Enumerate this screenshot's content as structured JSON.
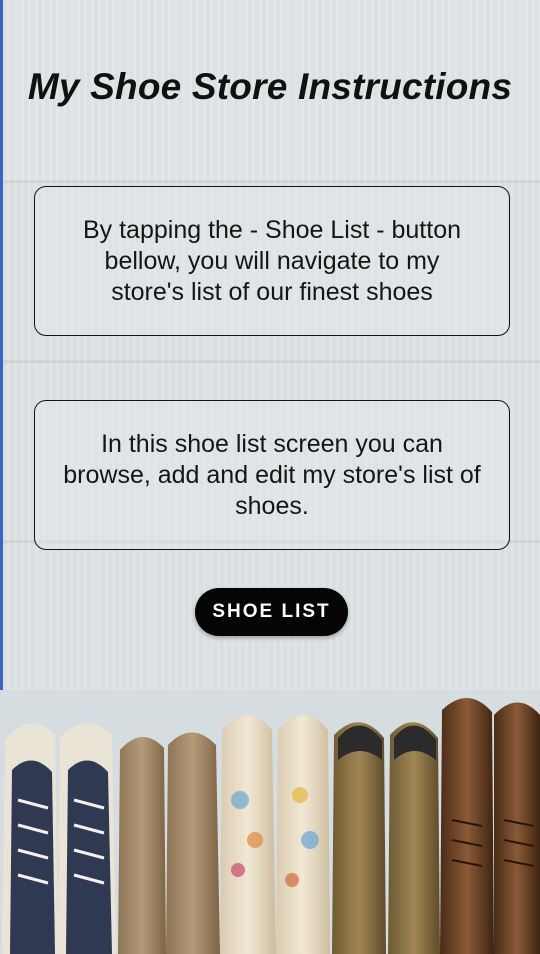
{
  "screen": {
    "title": "My Shoe Store Instructions",
    "instruction_1": "By tapping the - Shoe List - button bellow, you will navigate to my store's list of our finest shoes",
    "instruction_2": "In this shoe list screen you can browse, add and edit my store's list of shoes.",
    "shoe_list_button": "SHOE LIST"
  },
  "colors": {
    "accent_left_edge": "#3b62c8",
    "button_background": "#050505",
    "button_text": "#ffffff",
    "text": "#111111"
  }
}
